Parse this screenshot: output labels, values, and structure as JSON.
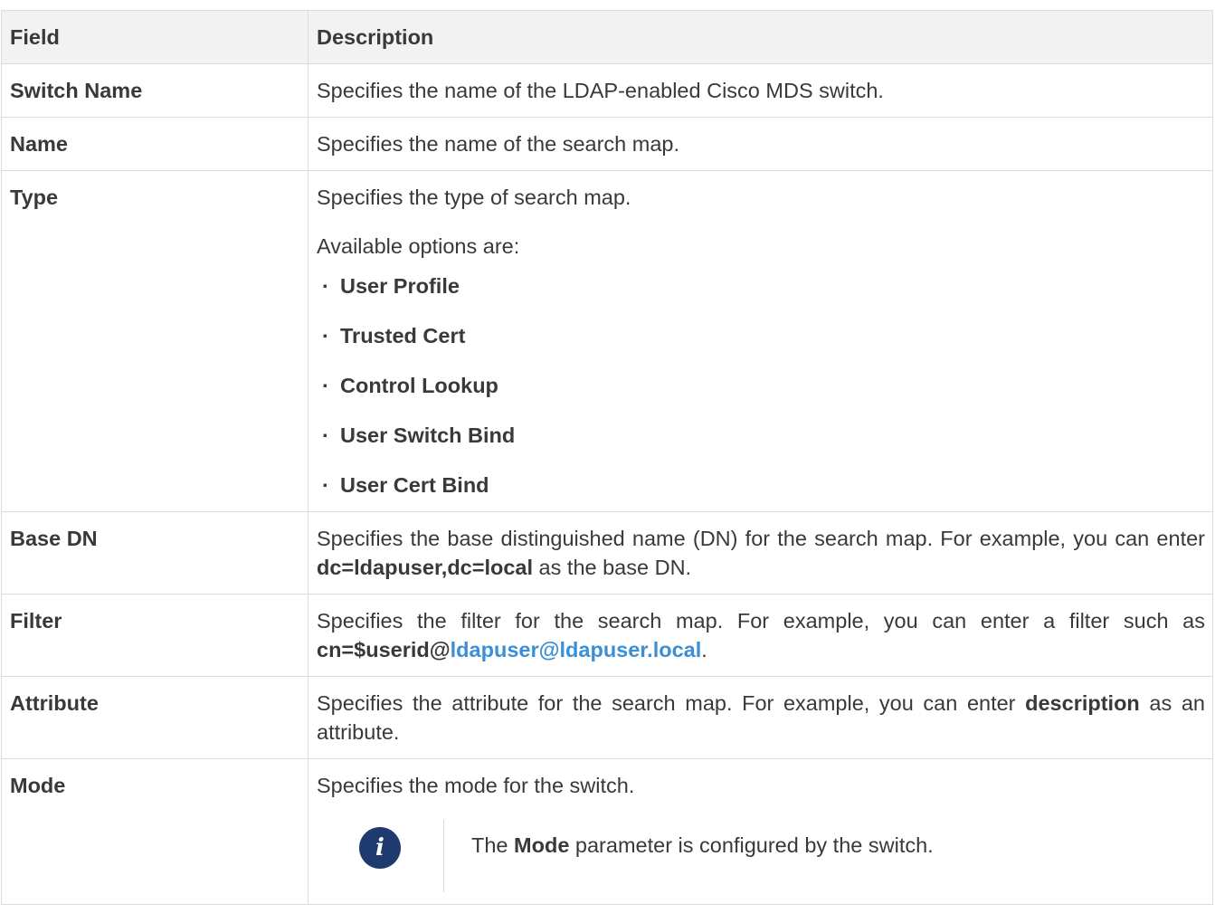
{
  "table": {
    "headers": [
      "Field",
      "Description"
    ],
    "rows": {
      "switch_name": {
        "field": "Switch Name",
        "desc": "Specifies the name of the LDAP-enabled Cisco MDS switch."
      },
      "name": {
        "field": "Name",
        "desc": "Specifies the name of the search map."
      },
      "type": {
        "field": "Type",
        "desc": "Specifies the type of search map.",
        "options_intro": "Available options are:",
        "options": [
          "User Profile",
          "Trusted Cert",
          "Control Lookup",
          "User Switch Bind",
          "User Cert Bind"
        ]
      },
      "base_dn": {
        "field": "Base DN",
        "desc_pre": "Specifies the base distinguished name (DN) for the search map. For example, you can enter ",
        "desc_bold": "dc=ldapuser,dc=local",
        "desc_post": " as the base DN."
      },
      "filter": {
        "field": "Filter",
        "desc_pre": "Specifies the filter for the search map. For example, you can enter a filter such as ",
        "desc_bold": "cn=$userid@",
        "desc_link": "ldapuser@ldapuser.local",
        "desc_post": "."
      },
      "attribute": {
        "field": "Attribute",
        "desc_pre": "Specifies the attribute for the search map. For example, you can enter ",
        "desc_bold": "description",
        "desc_post": " as an attribute."
      },
      "mode": {
        "field": "Mode",
        "desc": "Specifies the mode for the switch.",
        "note_pre": "The ",
        "note_bold": "Mode",
        "note_post": " parameter is configured by the switch.",
        "note_icon_glyph": "i"
      }
    }
  }
}
